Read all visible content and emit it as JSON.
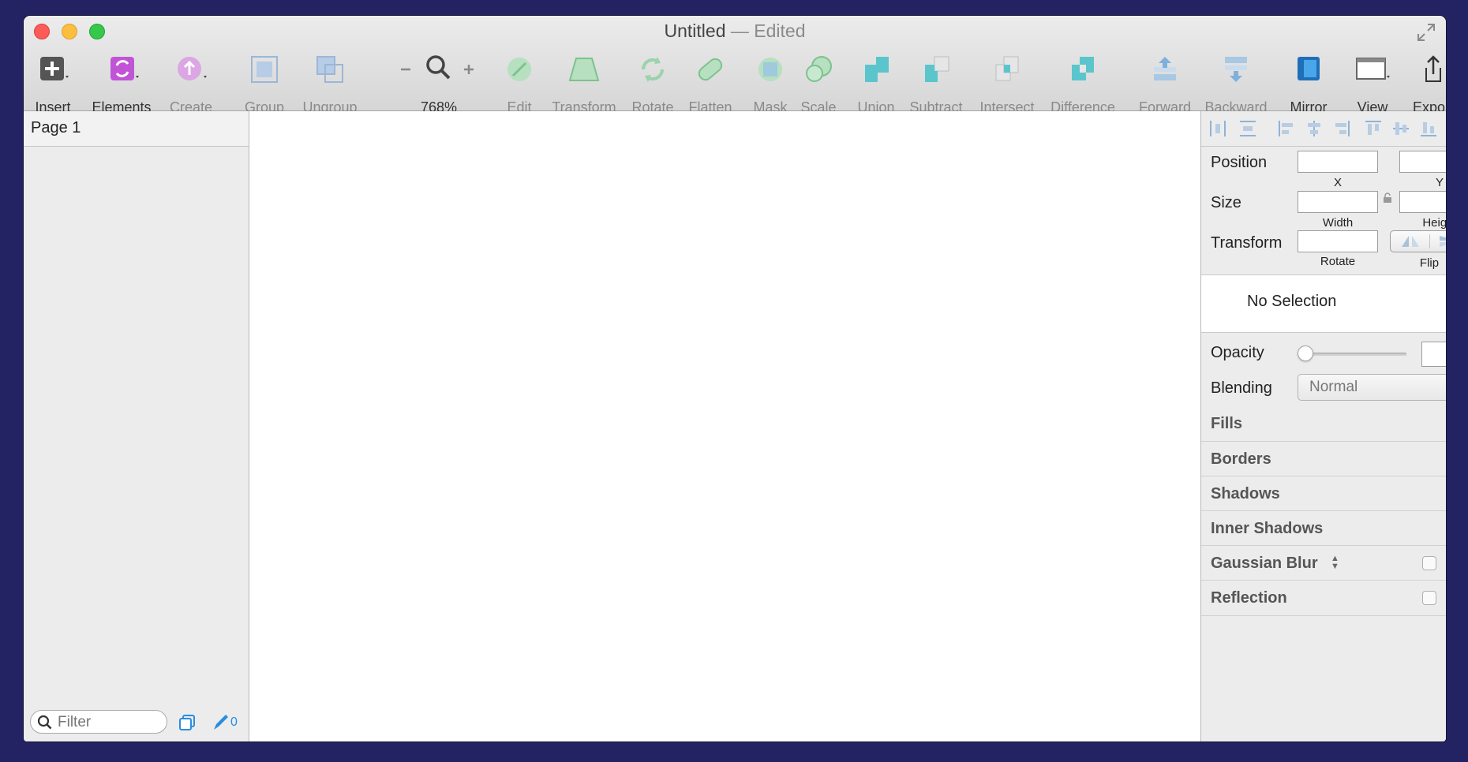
{
  "window": {
    "title": "Untitled",
    "title_suffix": "— Edited"
  },
  "toolbar": {
    "insert": "Insert",
    "elements": "Elements",
    "create": "Create",
    "group": "Group",
    "ungroup": "Ungroup",
    "zoom": "768%",
    "edit": "Edit",
    "transform": "Transform",
    "rotate": "Rotate",
    "flatten": "Flatten",
    "mask": "Mask",
    "scale": "Scale",
    "union": "Union",
    "subtract": "Subtract",
    "intersect": "Intersect",
    "difference": "Difference",
    "forward": "Forward",
    "backward": "Backward",
    "mirror": "Mirror",
    "view": "View",
    "export": "Export"
  },
  "pages": {
    "items": [
      {
        "label": "Page 1"
      }
    ]
  },
  "filter": {
    "placeholder": "Filter",
    "count": "0"
  },
  "inspector": {
    "position_label": "Position",
    "x_label": "X",
    "y_label": "Y",
    "size_label": "Size",
    "width_label": "Width",
    "height_label": "Height",
    "transform_label": "Transform",
    "rotate_label": "Rotate",
    "flip_label": "Flip",
    "no_selection": "No Selection",
    "opacity_label": "Opacity",
    "opacity_value": 0,
    "blending_label": "Blending",
    "blending_value": "Normal",
    "sections": {
      "fills": "Fills",
      "borders": "Borders",
      "shadows": "Shadows",
      "inner_shadows": "Inner Shadows",
      "gaussian_blur": "Gaussian Blur",
      "reflection": "Reflection"
    }
  },
  "colors": {
    "desktop": "#232363",
    "accent_blue": "#2a8ee0",
    "elements_purple": "#c154d6",
    "boolean_teal": "#5ac6cc"
  }
}
